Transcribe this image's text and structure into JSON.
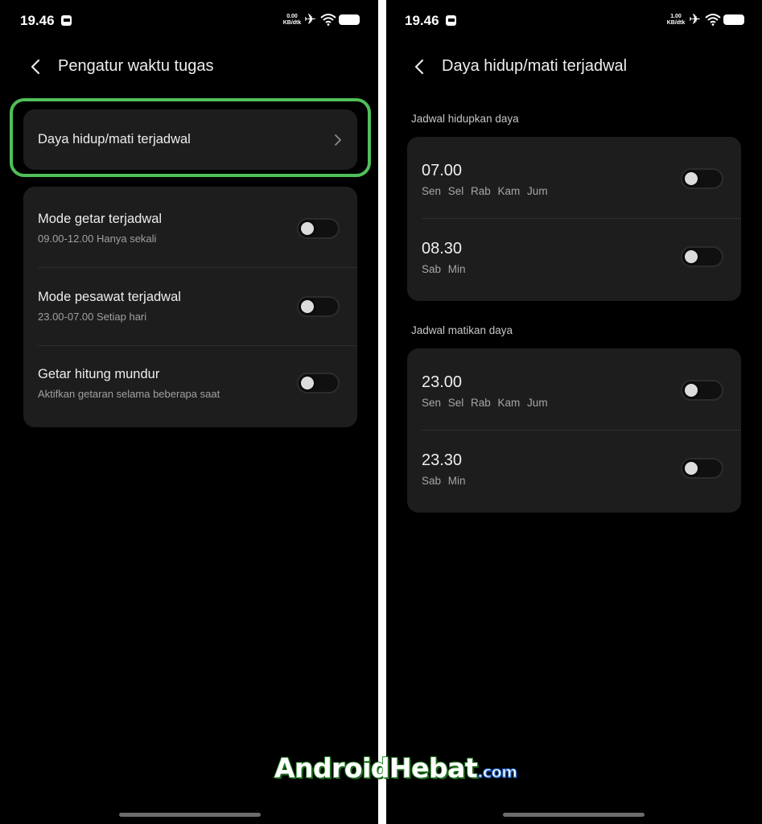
{
  "status_bar": {
    "left": {
      "time": "19.46",
      "net_speed_value": "0.00",
      "net_speed_unit": "KB/dtk"
    },
    "right": {
      "time": "19.46",
      "net_speed_value": "1.00",
      "net_speed_unit": "KB/dtk"
    }
  },
  "left_screen": {
    "title": "Pengatur waktu tugas",
    "highlighted_item": {
      "label": "Daya hidup/mati terjadwal"
    },
    "items": [
      {
        "label": "Mode getar terjadwal",
        "subtitle": "09.00-12.00 Hanya sekali",
        "enabled": false
      },
      {
        "label": "Mode pesawat terjadwal",
        "subtitle": "23.00-07.00 Setiap hari",
        "enabled": false
      },
      {
        "label": "Getar hitung mundur",
        "subtitle": "Aktifkan getaran selama beberapa saat",
        "enabled": false
      }
    ]
  },
  "right_screen": {
    "title": "Daya hidup/mati terjadwal",
    "sections": [
      {
        "label": "Jadwal hidupkan daya",
        "entries": [
          {
            "time": "07.00",
            "days": "Sen Sel Rab Kam Jum",
            "enabled": false
          },
          {
            "time": "08.30",
            "days": "Sab Min",
            "enabled": false
          }
        ]
      },
      {
        "label": "Jadwal matikan daya",
        "entries": [
          {
            "time": "23.00",
            "days": "Sen Sel Rab Kam Jum",
            "enabled": false
          },
          {
            "time": "23.30",
            "days": "Sab Min",
            "enabled": false
          }
        ]
      }
    ]
  },
  "watermark": {
    "main": "AndroidHebat",
    "suffix": ".com"
  },
  "colors": {
    "highlight": "#4fbf58",
    "card": "#1d1d1d",
    "background": "#000000"
  },
  "icons": [
    "back-arrow-icon",
    "chevron-right-icon",
    "airplane-icon",
    "wifi-icon",
    "battery-icon",
    "notification-icon"
  ]
}
